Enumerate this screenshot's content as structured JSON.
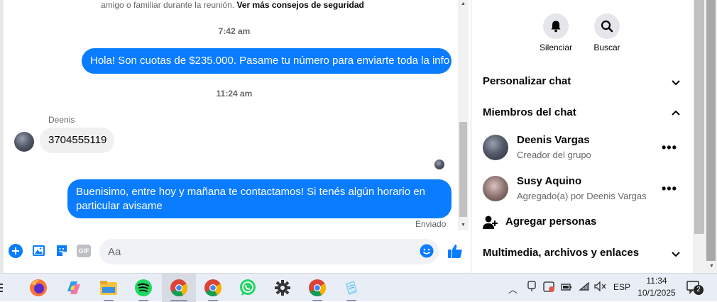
{
  "chat": {
    "security_note_prefix": "amigo o familiar durante la reunión.",
    "security_note_link": "Ver más consejos de seguridad",
    "timestamp_1": "7:42 am",
    "timestamp_2": "11:24 am",
    "messages": [
      {
        "direction": "out",
        "text": "Hola! Son cuotas de $235.000. Pasame tu número para enviarte toda la info"
      },
      {
        "direction": "in",
        "sender": "Deenis",
        "text": "3704555119"
      },
      {
        "direction": "out",
        "text": "Buenisimo, entre hoy y mañana te contactamos! Si tenés algún horario en particular avisame",
        "status": "Enviado"
      }
    ]
  },
  "composer": {
    "placeholder": "Aa",
    "gif_label": "GIF",
    "icons": [
      "plus-circle-icon",
      "photo-icon",
      "sticker-icon",
      "gif-icon",
      "emoji-icon",
      "like-icon"
    ]
  },
  "side_panel": {
    "actions": [
      {
        "label": "Silenciar",
        "icon": "bell-icon"
      },
      {
        "label": "Buscar",
        "icon": "search-icon"
      }
    ],
    "sections": {
      "customize": "Personalizar chat",
      "members": "Miembros del chat",
      "media": "Multimedia, archivos y enlaces"
    },
    "members": [
      {
        "name": "Deenis Vargas",
        "role": "Creador del grupo"
      },
      {
        "name": "Susy Aquino",
        "role": "Agregado(a) por Deenis Vargas"
      }
    ],
    "add_people": "Agregar personas"
  },
  "taskbar": {
    "apps": [
      "firefox-icon",
      "copilot-icon",
      "file-explorer-icon",
      "spotify-icon",
      "chrome-icon",
      "chrome-icon",
      "whatsapp-icon",
      "settings-icon",
      "chrome-icon",
      "notepad-icon"
    ],
    "language": "ESP",
    "time": "11:34",
    "date": "10/1/2025",
    "notification_count": "2"
  },
  "colors": {
    "accent": "#0a7cff",
    "bubble_in": "#f0f0f0",
    "taskbar_bg": "#e9eef6"
  }
}
